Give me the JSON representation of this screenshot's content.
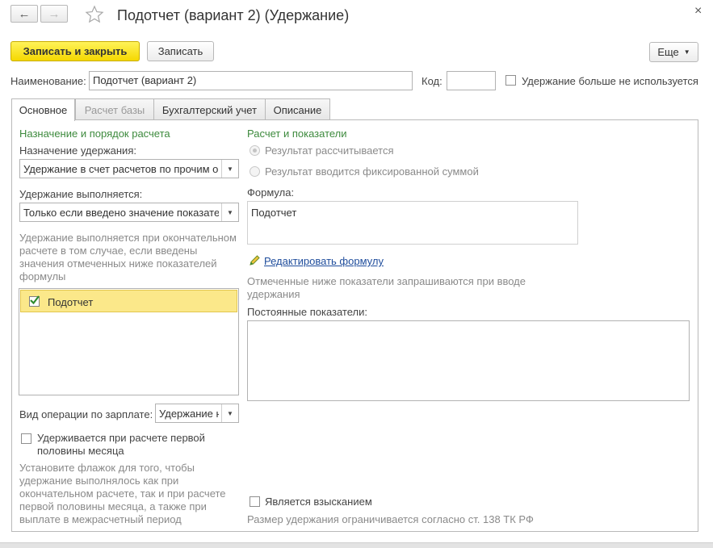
{
  "window": {
    "title": "Подотчет (вариант 2) (Удержание)",
    "close_glyph": "×"
  },
  "toolbar": {
    "save_close": "Записать и закрыть",
    "save": "Записать",
    "more": "Еще"
  },
  "header": {
    "name_label": "Наименование:",
    "name_value": "Подотчет (вариант 2)",
    "code_label": "Код:",
    "code_value": "",
    "unused_label": "Удержание больше не используется"
  },
  "tabs": [
    {
      "label": "Основное"
    },
    {
      "label": "Расчет базы"
    },
    {
      "label": "Бухгалтерский учет"
    },
    {
      "label": "Описание"
    }
  ],
  "left": {
    "section_title": "Назначение и порядок расчета",
    "purpose_label": "Назначение удержания:",
    "purpose_value": "Удержание в счет расчетов по прочим операциям",
    "performed_label": "Удержание выполняется:",
    "performed_value": "Только если введено значение показателя",
    "performed_hint": "Удержание выполняется при окончательном расчете в том случае, если введены значения отмеченных ниже показателей формулы",
    "indicators": [
      {
        "label": "Подотчет",
        "checked": true
      }
    ],
    "operation_label": "Вид операции по зарплате:",
    "operation_value": "Удержание не является",
    "first_half_label": "Удерживается при расчете первой половины месяца",
    "first_half_hint": "Установите флажок для того, чтобы удержание выполнялось как при окончательном расчете, так и при расчете первой половины месяца, а также при выплате в межрасчетный период"
  },
  "right": {
    "section_title": "Расчет и показатели",
    "radio_calc": "Результат рассчитывается",
    "radio_fixed": "Результат вводится фиксированной суммой",
    "formula_label": "Формула:",
    "formula_value": "Подотчет",
    "edit_formula": "Редактировать формулу",
    "requested_hint": "Отмеченные ниже показатели запрашиваются при вводе удержания",
    "constant_label": "Постоянные показатели:",
    "recovery_label": "Является взысканием",
    "limit_hint": "Размер удержания ограничивается согласно ст. 138 ТК РФ"
  },
  "colors": {
    "primary": "#f5d800",
    "section_title": "#3d8a3d",
    "selected_row": "#fbe88a",
    "link": "#1f4d9c"
  }
}
